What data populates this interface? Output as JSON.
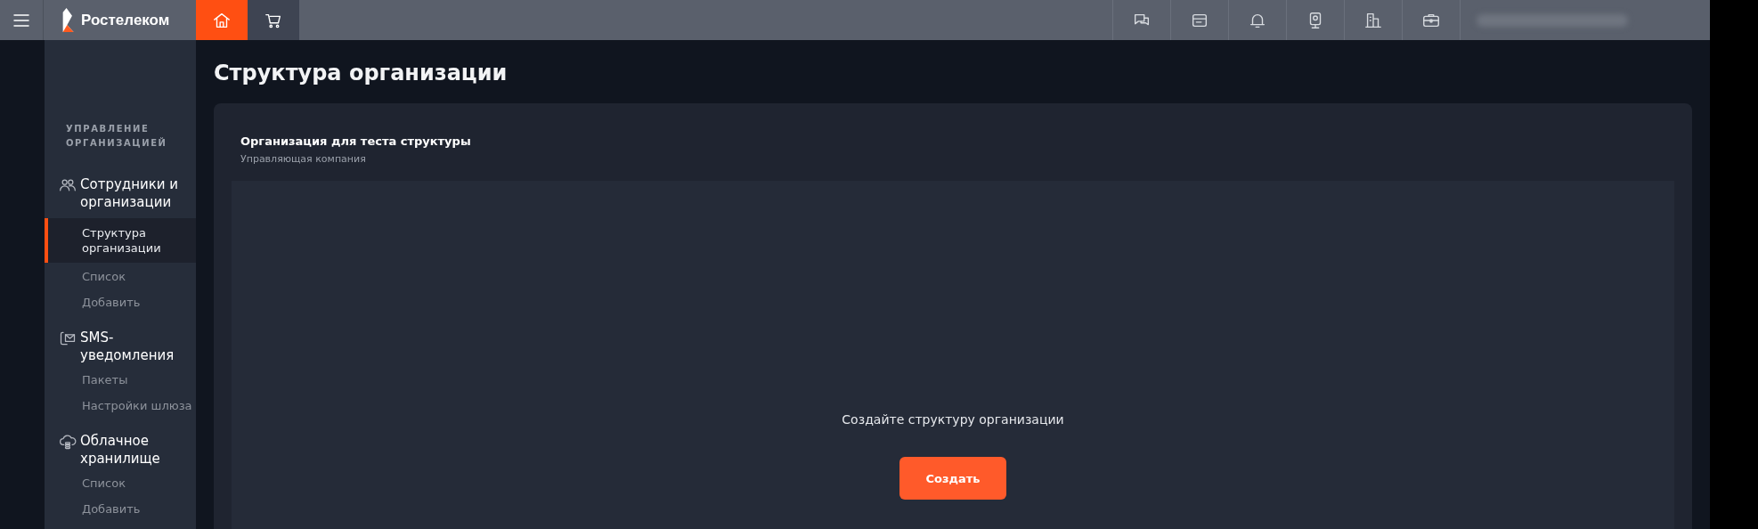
{
  "header": {
    "logo_text": "Ростелеком",
    "tabs": [
      {
        "kind": "home",
        "selected": true
      },
      {
        "kind": "cart",
        "selected": false
      }
    ],
    "actions": [
      {
        "kind": "chat"
      },
      {
        "kind": "card"
      },
      {
        "kind": "bell"
      },
      {
        "kind": "camera"
      },
      {
        "kind": "building"
      },
      {
        "kind": "briefcase"
      }
    ]
  },
  "sidebar": {
    "section_title": "УПРАВЛЕНИЕ ОРГАНИЗАЦИЕЙ",
    "groups": [
      {
        "kind": "people",
        "label": "Сотрудники и организации",
        "children": [
          {
            "label": "Структура организации",
            "selected": true
          },
          {
            "label": "Список",
            "selected": false
          },
          {
            "label": "Добавить",
            "selected": false
          }
        ]
      },
      {
        "kind": "sms",
        "label": "SMS-уведомления",
        "children": [
          {
            "label": "Пакеты",
            "selected": false
          },
          {
            "label": "Настройки шлюза",
            "selected": false
          }
        ]
      },
      {
        "kind": "cloud",
        "label": "Облачное хранилище",
        "children": [
          {
            "label": "Список",
            "selected": false
          },
          {
            "label": "Добавить",
            "selected": false
          }
        ]
      }
    ]
  },
  "page": {
    "title": "Структура организации",
    "organization": {
      "name": "Организация для теста структуры",
      "type": "Управляющая компания"
    },
    "empty_state": {
      "message": "Создайте структуру организации",
      "button": "Создать"
    }
  }
}
